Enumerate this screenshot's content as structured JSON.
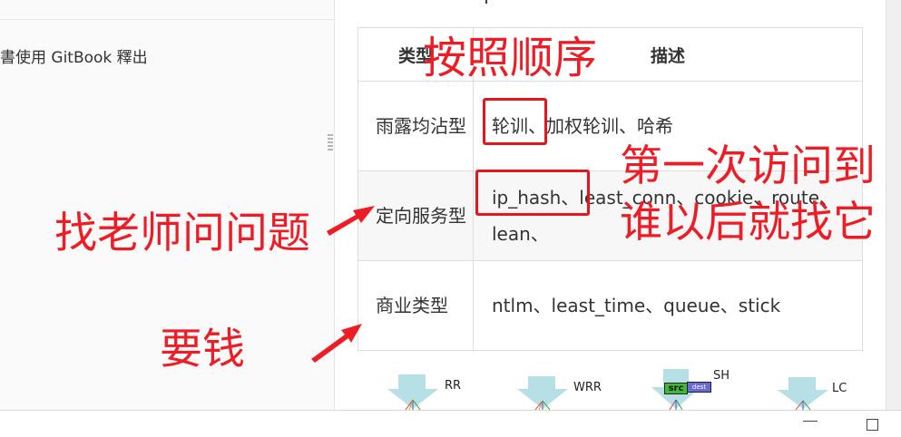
{
  "sidebar": {
    "publish_text": "書使用 GitBook 釋出"
  },
  "table": {
    "headers": [
      "类型",
      "描述"
    ],
    "rows": [
      {
        "type": "雨露均沾型",
        "desc": "轮训、加权轮训、哈希"
      },
      {
        "type": "定向服务型",
        "desc": "ip_hash、least_conn、cookie、route、lean、"
      },
      {
        "type": "商业类型",
        "desc": "ntlm、least_time、queue、stick"
      }
    ]
  },
  "annotations": {
    "in_order": "按照顺序",
    "first_visit_1": "第一次访问到",
    "first_visit_2": "谁以后就找它",
    "ask_teacher": "找老师问问题",
    "money": "要钱"
  },
  "diagram": {
    "labels": [
      "RR",
      "WRR",
      "SH",
      "LC"
    ],
    "src_tag": "src",
    "dest_tag": "dest"
  },
  "colors": {
    "annotation": "#ee1c24",
    "highlight_box": "#e8141b",
    "arrow_body": "#b7dfe6",
    "src_tag": "#3fb93a",
    "dest_tag": "#6a6ad0"
  },
  "icons": [
    "drag-handle-icon",
    "minimize-icon",
    "maximize-icon",
    "arrow-icon"
  ]
}
